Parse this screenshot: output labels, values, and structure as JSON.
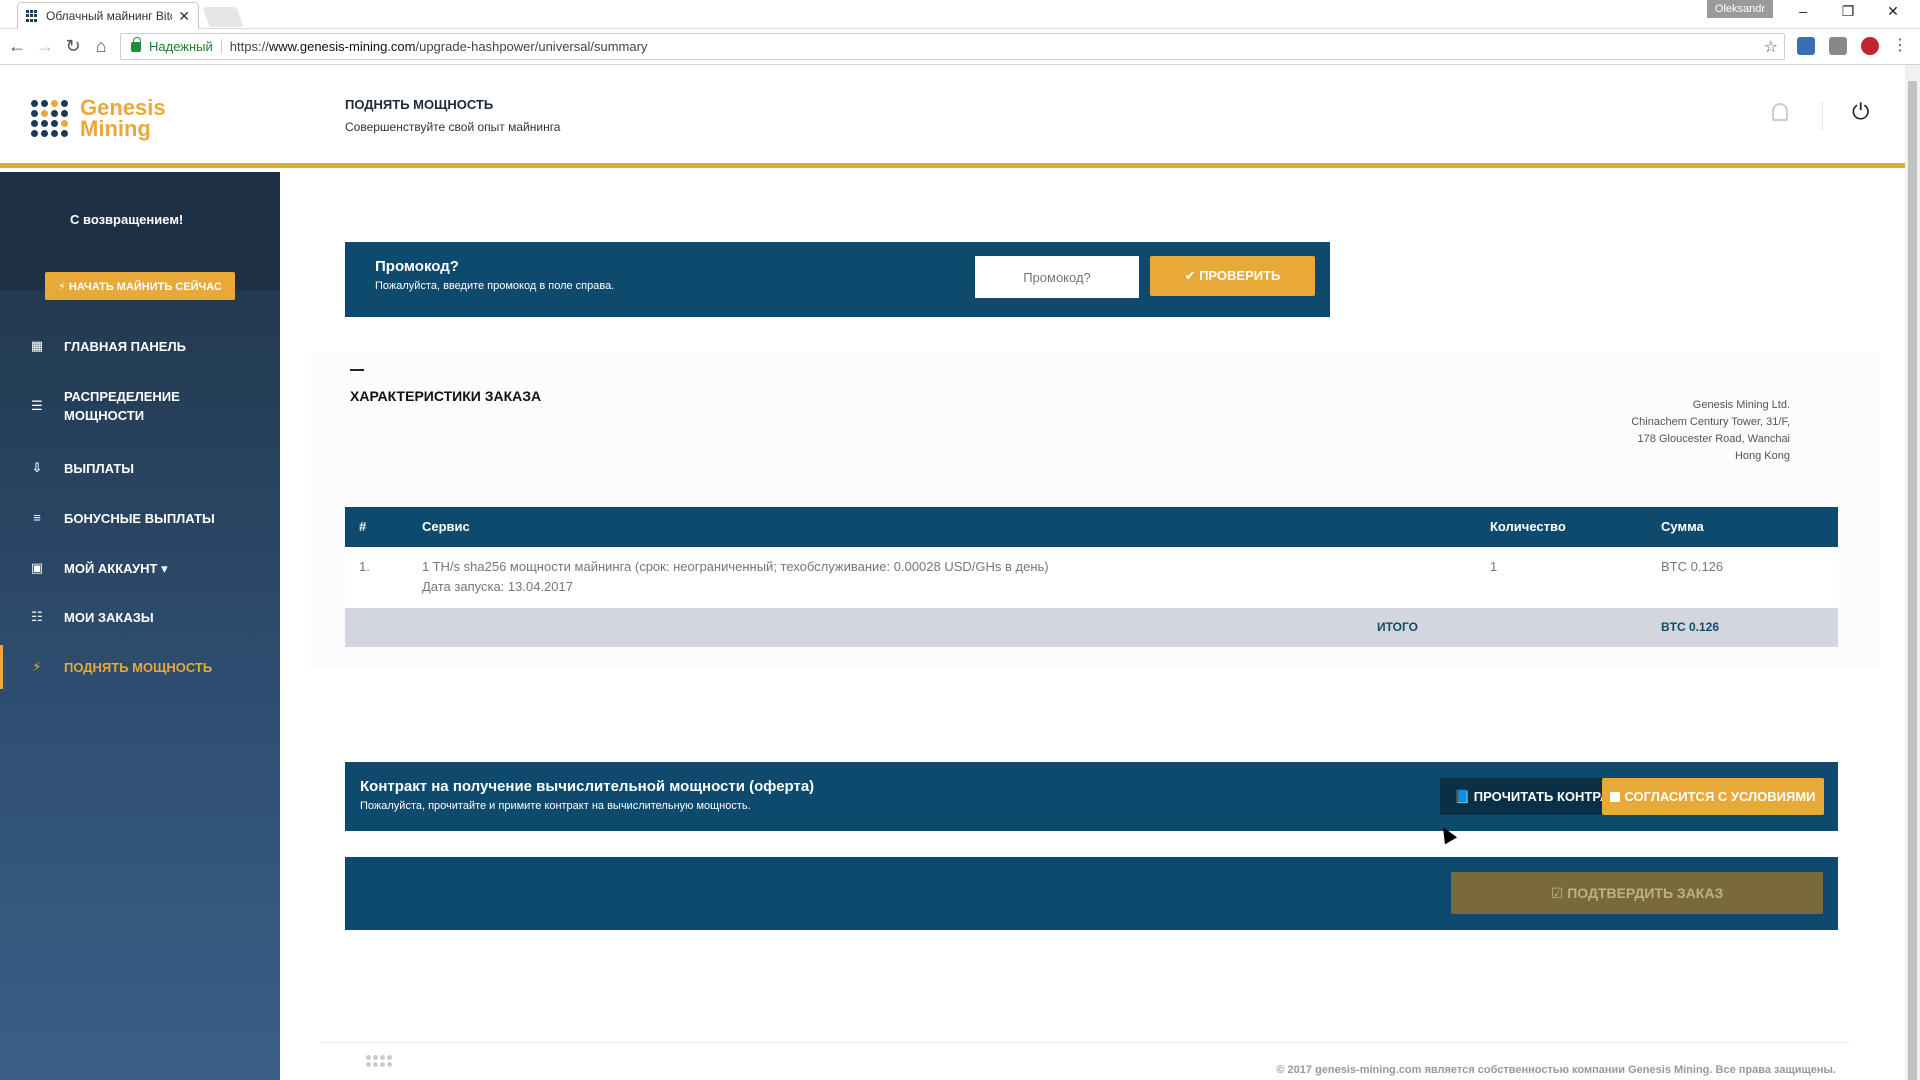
{
  "browser": {
    "tab_title": "Облачный майнинг Bitc",
    "tab_close": "✕",
    "user": "Oleksandr",
    "secure_label": "Надежный",
    "url_prefix": "https://",
    "url_host": "www.genesis-mining.com",
    "url_path": "/upgrade-hashpower/universal/summary",
    "icons": {
      "back": "back-arrow-icon",
      "forward": "forward-arrow-icon",
      "reload": "reload-icon",
      "home": "home-icon",
      "star": "bookmark-star-icon"
    }
  },
  "header": {
    "logo_line1": "Genesis",
    "logo_line2": "Mining",
    "title": "ПОДНЯТЬ МОЩНОСТЬ",
    "subtitle": "Совершенствуйте свой опыт майнинга"
  },
  "sidebar": {
    "welcome": "С возвращением!",
    "start_button": "⚡ НАЧАТЬ МАЙНИТЬ СЕЙЧАС",
    "items": [
      {
        "label": "ГЛАВНАЯ ПАНЕЛЬ",
        "icon": "dashboard-icon"
      },
      {
        "label": "РАСПРЕДЕЛЕНИЕ",
        "label2": "МОЩНОСТИ",
        "icon": "sliders-icon"
      },
      {
        "label": "ВЫПЛАТЫ",
        "icon": "download-icon"
      },
      {
        "label": "БОНУСНЫЕ ВЫПЛАТЫ",
        "icon": "list-icon"
      },
      {
        "label": "МОЙ АККАУНТ ▾",
        "icon": "user-card-icon"
      },
      {
        "label": "МОИ ЗАКАЗЫ",
        "icon": "list-bullets-icon"
      },
      {
        "label": "ПОДНЯТЬ МОЩНОСТЬ",
        "icon": "lightning-icon"
      }
    ]
  },
  "promo": {
    "title": "Промокод?",
    "subtitle": "Пожалуйста, введите промокод в поле справа.",
    "placeholder": "Промокод?",
    "button": "✔ ПРОВЕРИТЬ"
  },
  "order": {
    "title": "ХАРАКТЕРИСТИКИ ЗАКАЗА",
    "address": [
      "Genesis Mining Ltd.",
      "Chinachem Century Tower, 31/F,",
      "178 Gloucester Road, Wanchai",
      "Hong Kong"
    ],
    "columns": [
      "#",
      "Сервис",
      "Количество",
      "Сумма"
    ],
    "rows": [
      {
        "num": "1.",
        "service": "1  TH/s sha256 мощности майнинга (срок: неограниченный; техобслуживание: 0.00028 USD/GHs в день)",
        "start_date": "Дата запуска: 13.04.2017",
        "qty": "1",
        "sum": "BTC 0.126"
      }
    ],
    "total_label": "ИТОГО",
    "total_value": "BTC 0.126"
  },
  "contract": {
    "title": "Контракт на получение вычислительной мощности (оферта)",
    "subtitle": "Пожалуйста, прочитайте и примите контракт на вычислительную мощность.",
    "read_button": "📘 ПРОЧИТАТЬ КОНТРАКТ",
    "agree_button": "СОГЛАСИТСЯ С УСЛОВИЯМИ"
  },
  "confirm": {
    "button": "☑ ПОДТВЕРДИТЬ ЗАКАЗ"
  },
  "footer": {
    "copyright": "© 2017 genesis-mining.com является собственностью компании Genesis Mining. Все права защищены."
  },
  "colors": {
    "accent": "#e7a938",
    "navy": "#0e4a6e",
    "sidebar": "#2f4f72"
  }
}
